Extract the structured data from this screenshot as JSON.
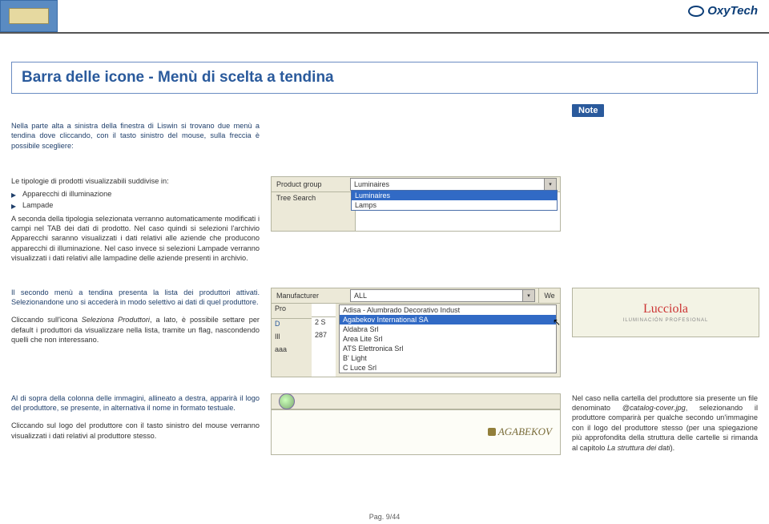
{
  "header": {
    "logo": "OxyTech"
  },
  "title": "Barra delle icone - Menù di scelta a tendina",
  "note_label": "Note",
  "intro": "Nella parte alta a sinistra della finestra di Liswin si trovano due menù a tendina dove cliccando, con il tasto sinistro del mouse, sulla freccia è possibile scegliere:",
  "section1": {
    "line1": "Le tipologie di prodotti visualizzabili suddivise in:",
    "b1": "Apparecchi di illuminazione",
    "b2": "Lampade",
    "body": "A seconda della tipologia selezionata verranno automaticamente modificati i campi nel TAB dei dati di prodotto. Nel caso quindi si selezioni l'archivio Apparecchi saranno visualizzati i dati relativi alle aziende che producono apparecchi di illuminazione. Nel caso invece si selezioni Lampade verranno visualizzati i dati relativi alle lampadine delle aziende presenti in archivio."
  },
  "mock1": {
    "label1": "Product group",
    "dd_value": "Luminaires",
    "opt1": "Luminaires",
    "opt2": "Lamps",
    "label2": "Tree Search"
  },
  "section2": {
    "p1": "Il secondo menù a tendina presenta la lista dei produttori attivati. Selezionandone uno si accederà in modo selettivo ai dati di quel produttore.",
    "p2a": "Cliccando sull'icona ",
    "p2i": "Seleziona Produttori",
    "p2b": ", a lato, è possibile settare per default i produttori da visualizzare nella lista, tramite un flag, nascondendo quelli che non interessano."
  },
  "mock2": {
    "label": "Manufacturer",
    "dd_value": "ALL",
    "web": "We",
    "o1": "Adisa - Alumbrado Decorativo Indust",
    "o2": "Agabekov International SA",
    "o3": "Aldabra Srl",
    "o4": "Area Lite Srl",
    "o5": "ATS Elettronica Srl",
    "o6": "B' Light",
    "o7": "C Luce Srl",
    "colhead": "Pro",
    "r1a": "D",
    "r1b": "2 S",
    "r2a": "Ill",
    "r2b": "287",
    "r3a": "aaa",
    "r3b": ""
  },
  "side2": {
    "brand": "Lucciola",
    "sub": "ILUMINACIÓN PROFESIONAL"
  },
  "section3": {
    "p1": "Al di sopra della colonna delle immagini, allineato a destra, apparirà il logo del produttore, se presente, in alternativa il nome in formato testuale.",
    "p2": "Cliccando sul logo del produttore con il tasto sinistro del mouse verranno visualizzati i dati relativi al produttore stesso."
  },
  "mock3": {
    "brand": "AGABEKOV"
  },
  "side3": {
    "t1": "Nel caso nella cartella del produttore sia presente un file denominato ",
    "fn": "@catalog-cover.jpg",
    "t2": ", selezionando il produttore comparirà per qualche secondo un'immagine con il logo del produttore stesso (per una spiegazione più approfondita della struttura delle cartelle si rimanda al capitolo ",
    "ch": "La struttura dei dati",
    "t3": ")."
  },
  "footer": "Pag. 9/44"
}
